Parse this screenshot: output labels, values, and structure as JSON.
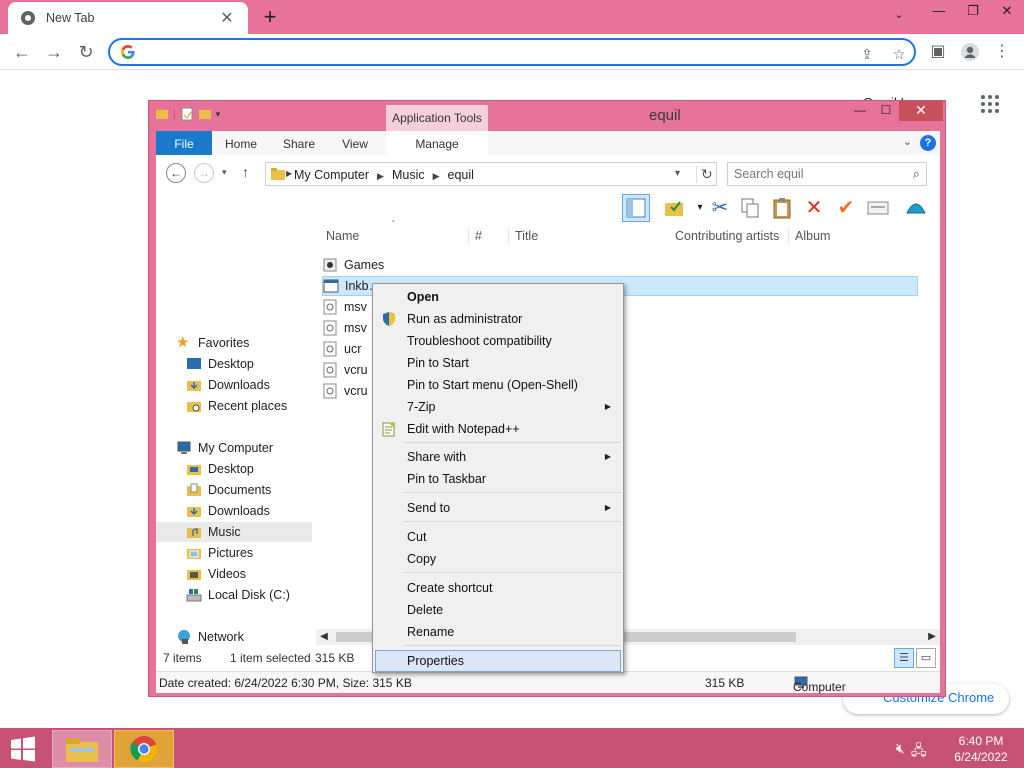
{
  "browser": {
    "tab_title": "New Tab",
    "tab_close": "✕",
    "new_tab": "+",
    "omnibox_value": "",
    "gmail_text": "Gmail  Images",
    "customize_label": "Customize Chrome"
  },
  "explorer": {
    "title": "equil",
    "app_tools": "Application Tools",
    "ribbon_tabs": [
      "File",
      "Home",
      "Share",
      "View",
      "Manage"
    ],
    "breadcrumbs": [
      "My Computer",
      "Music",
      "equil"
    ],
    "search_placeholder": "Search equil",
    "nav": {
      "favorites": "Favorites",
      "favorites_items": [
        "Desktop",
        "Downloads",
        "Recent places"
      ],
      "computer": "My Computer",
      "computer_items": [
        "Desktop",
        "Documents",
        "Downloads",
        "Music",
        "Pictures",
        "Videos",
        "Local Disk (C:)"
      ],
      "network": "Network"
    },
    "columns": [
      "Name",
      "#",
      "Title",
      "Contributing artists",
      "Album"
    ],
    "files": [
      "Games",
      "Inkb…",
      "msv",
      "msv",
      "ucr",
      "vcru",
      "vcru"
    ],
    "status": {
      "items": "7 items",
      "selected": "1 item selected",
      "size": "315 KB"
    },
    "details": {
      "created": "Date created: 6/24/2022 6:30 PM, Size: 315 KB",
      "size": "315 KB",
      "location": "Computer"
    }
  },
  "context_menu": {
    "open": "Open",
    "run_admin": "Run as administrator",
    "troubleshoot": "Troubleshoot compatibility",
    "pin_start": "Pin to Start",
    "pin_start_menu": "Pin to Start menu (Open-Shell)",
    "zip": "7-Zip",
    "notepad": "Edit with Notepad++",
    "share_with": "Share with",
    "pin_taskbar": "Pin to Taskbar",
    "send_to": "Send to",
    "cut": "Cut",
    "copy": "Copy",
    "create_shortcut": "Create shortcut",
    "delete": "Delete",
    "rename": "Rename",
    "properties": "Properties"
  },
  "taskbar": {
    "time": "6:40 PM",
    "date": "6/24/2022"
  },
  "colors": {
    "accent_pink": "#e8739a",
    "taskbar": "#c55274",
    "chrome_blue": "#1a73e8"
  }
}
